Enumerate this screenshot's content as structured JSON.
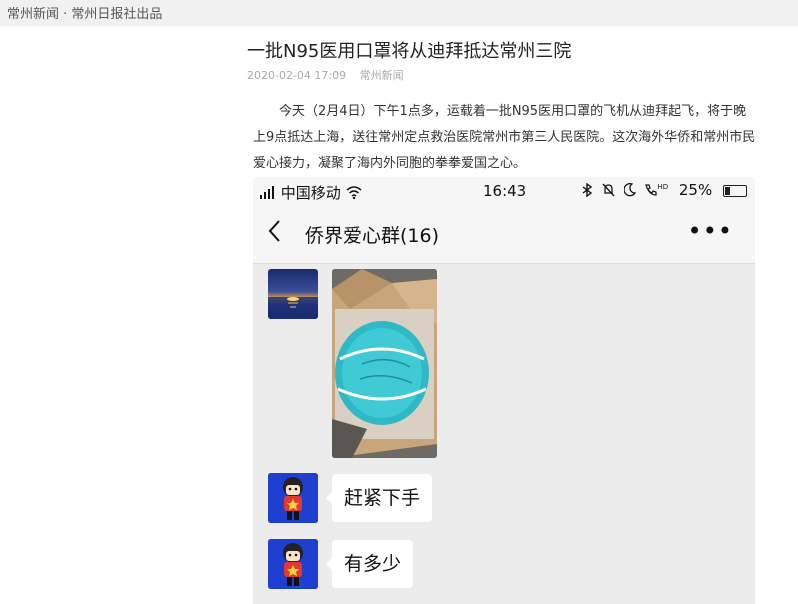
{
  "topbar": {
    "label": "常州新闻 · 常州日报社出品"
  },
  "article": {
    "title": "一批N95医用口罩将从迪拜抵达常州三院",
    "date": "2020-02-04 17:09",
    "source": "常州新闻",
    "body": "今天（2月4日）下午1点多，运载着一批N95医用口罩的飞机从迪拜起飞，将于晚上9点抵达上海，送往常州定点救治医院常州市第三人民医院。这次海外华侨和常州市民爱心接力，凝聚了海内外同胞的拳拳爱国之心。"
  },
  "phone": {
    "status": {
      "carrier": "中国移动",
      "time": "16:43",
      "hd": "HD",
      "battery": "25%",
      "battery_level": 0.25
    },
    "chat": {
      "title": "侨界爱心群(16)",
      "back_icon": "chevron-left-icon",
      "more_icon": "more-dots-icon",
      "more_glyph": "•••",
      "messages": [
        {
          "type": "image",
          "avatar": "sunset-avatar",
          "content": "n95-mask-photo"
        },
        {
          "type": "text",
          "avatar": "cartoon-kid-avatar",
          "text": "赶紧下手"
        },
        {
          "type": "text",
          "avatar": "cartoon-kid-avatar",
          "text": "有多少"
        }
      ]
    }
  }
}
